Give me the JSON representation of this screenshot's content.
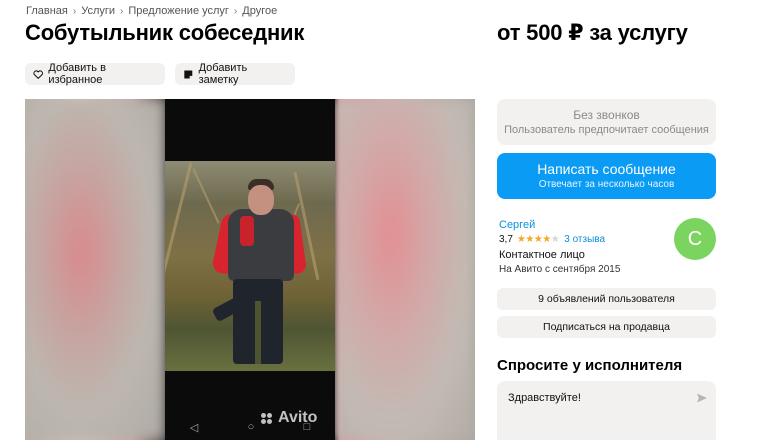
{
  "breadcrumb": [
    "Главная",
    "Услуги",
    "Предложение услуг",
    "Другое"
  ],
  "breadcrumb_separator": "›",
  "title": "Собутыльник собеседник",
  "price": "от 500 ₽ за услугу",
  "actions": {
    "favorite_label": "Добавить в избранное",
    "favorite_icon": "heart-icon",
    "note_label": "Добавить заметку",
    "note_icon": "note-icon"
  },
  "gallery": {
    "watermark": "Avito",
    "nav": [
      "◁",
      "○",
      "□"
    ]
  },
  "contact": {
    "no_calls_title": "Без звонков",
    "no_calls_subtitle": "Пользователь предпочитает сообщения",
    "write_label": "Написать сообщение",
    "write_subtitle": "Отвечает за несколько часов"
  },
  "seller": {
    "name": "Сергей",
    "rating": "3,7",
    "rating_value": 3.7,
    "stars_filled": "★★★★",
    "stars_empty": "★",
    "reviews": "3 отзыва",
    "role": "Контактное лицо",
    "since": "На Авито с сентября 2015",
    "avatar_letter": "С",
    "avatar_color": "#7cd460"
  },
  "seller_actions": {
    "ads_label": "9 объявлений пользователя",
    "subscribe_label": "Подписаться на продавца"
  },
  "ask": {
    "title": "Спросите у исполнителя",
    "message": "Здравствуйте!",
    "send_icon": "send-icon"
  },
  "colors": {
    "accent": "#0a9bf5",
    "link": "#0a8fdc",
    "chip_bg": "#f2f1f0",
    "star": "#f5a623"
  }
}
